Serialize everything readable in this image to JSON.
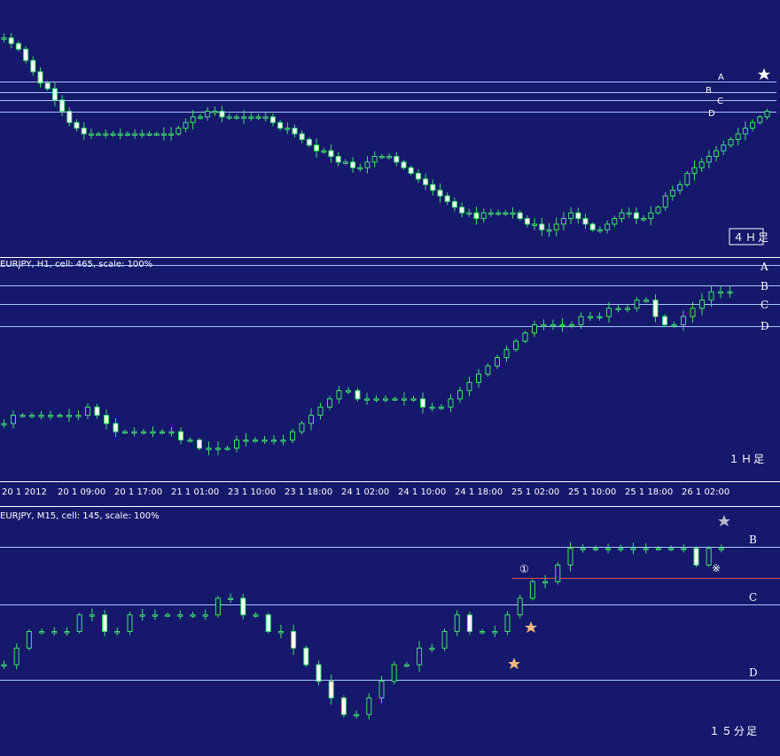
{
  "colors": {
    "background": "#16186b",
    "candle": "#3fe06a",
    "bear_body": "#ffffff",
    "level_line": "#a7c7ff",
    "separator": "#ffffff",
    "red_line": "#d45050",
    "star_white": "#ffffff",
    "star_gray": "#b7b7c9",
    "star_orange": "#f3b87b"
  },
  "panes": {
    "h4": {
      "timeframe_label": "４Ｈ足",
      "levels": [
        "A",
        "B",
        "C",
        "D"
      ]
    },
    "h1": {
      "header": "EURJPY, H1, cell: 465, scale: 100%",
      "timeframe_label": "１Ｈ足",
      "levels": [
        "A",
        "B",
        "C",
        "D"
      ],
      "time_axis": [
        "20 1 2012",
        "20 1 09:00",
        "20 1 17:00",
        "21 1 01:00",
        "23 1 10:00",
        "23 1 18:00",
        "24 1 02:00",
        "24 1 10:00",
        "24 1 18:00",
        "25 1 02:00",
        "25 1 10:00",
        "25 1 18:00",
        "26 1 02:00"
      ]
    },
    "m15": {
      "header": "EURJPY, M15, cell: 145, scale: 100%",
      "timeframe_label": "１５分足",
      "levels": [
        "B",
        "C",
        "D"
      ],
      "circled_mark": "①",
      "x_mark": "※"
    }
  },
  "chart_data": [
    {
      "type": "candlestick",
      "pane": "4H",
      "close": [
        96.0,
        95.9,
        95.8,
        95.6,
        95.4,
        95.2,
        95.1,
        94.9,
        94.7,
        94.5,
        94.4,
        94.3,
        94.3,
        94.3,
        94.3,
        94.3,
        94.3,
        94.3,
        94.3,
        94.3,
        94.3,
        94.3,
        94.3,
        94.3,
        94.4,
        94.5,
        94.6,
        94.6,
        94.7,
        94.7,
        94.6,
        94.6,
        94.6,
        94.6,
        94.6,
        94.6,
        94.6,
        94.5,
        94.4,
        94.4,
        94.3,
        94.2,
        94.1,
        94.0,
        94.0,
        93.9,
        93.8,
        93.8,
        93.7,
        93.7,
        93.8,
        93.9,
        93.9,
        93.9,
        93.8,
        93.7,
        93.6,
        93.5,
        93.4,
        93.3,
        93.2,
        93.1,
        93.0,
        92.9,
        92.9,
        92.8,
        92.9,
        92.9,
        92.9,
        92.9,
        92.9,
        92.8,
        92.7,
        92.7,
        92.6,
        92.6,
        92.7,
        92.8,
        92.9,
        92.8,
        92.7,
        92.6,
        92.6,
        92.7,
        92.8,
        92.9,
        92.9,
        92.8,
        92.8,
        92.9,
        93.0,
        93.2,
        93.3,
        93.4,
        93.6,
        93.7,
        93.8,
        93.9,
        94.0,
        94.1,
        94.2,
        94.3,
        94.4,
        94.5,
        94.6,
        94.7
      ],
      "levels": [
        "A",
        "B",
        "C",
        "D"
      ]
    },
    {
      "type": "candlestick",
      "pane": "H1",
      "time_axis_labels": [
        "20 1 2012",
        "20 1 09:00",
        "20 1 17:00",
        "21 1 01:00",
        "23 1 10:00",
        "23 1 18:00",
        "24 1 02:00",
        "24 1 10:00",
        "24 1 18:00",
        "25 1 02:00",
        "25 1 10:00",
        "25 1 18:00",
        "26 1 02:00"
      ],
      "close": [
        93.1,
        93.2,
        93.2,
        93.2,
        93.2,
        93.2,
        93.2,
        93.2,
        93.2,
        93.3,
        93.2,
        93.1,
        93.0,
        93.0,
        93.0,
        93.0,
        93.0,
        93.0,
        93.0,
        92.9,
        92.9,
        92.8,
        92.8,
        92.8,
        92.8,
        92.9,
        92.9,
        92.9,
        92.9,
        92.9,
        92.9,
        93.0,
        93.1,
        93.2,
        93.3,
        93.4,
        93.5,
        93.5,
        93.4,
        93.4,
        93.4,
        93.4,
        93.4,
        93.4,
        93.4,
        93.3,
        93.3,
        93.3,
        93.4,
        93.5,
        93.6,
        93.7,
        93.8,
        93.9,
        94.0,
        94.1,
        94.2,
        94.3,
        94.3,
        94.3,
        94.3,
        94.3,
        94.4,
        94.4,
        94.4,
        94.5,
        94.5,
        94.5,
        94.6,
        94.6,
        94.4,
        94.3,
        94.3,
        94.4,
        94.5,
        94.6,
        94.7,
        94.7,
        94.7
      ],
      "levels": [
        "A",
        "B",
        "C",
        "D"
      ]
    },
    {
      "type": "candlestick",
      "pane": "M15",
      "close": [
        94.3,
        94.4,
        94.5,
        94.5,
        94.5,
        94.5,
        94.6,
        94.6,
        94.5,
        94.5,
        94.6,
        94.6,
        94.6,
        94.6,
        94.6,
        94.6,
        94.6,
        94.7,
        94.7,
        94.6,
        94.6,
        94.5,
        94.5,
        94.4,
        94.3,
        94.2,
        94.1,
        94.0,
        94.0,
        94.1,
        94.2,
        94.3,
        94.3,
        94.4,
        94.4,
        94.5,
        94.6,
        94.5,
        94.5,
        94.5,
        94.6,
        94.7,
        94.8,
        94.8,
        94.9,
        95.0,
        95.0,
        95.0,
        95.0,
        95.0,
        95.0,
        95.0,
        95.0,
        95.0,
        95.0,
        94.9,
        95.0,
        95.0
      ],
      "levels": [
        "B",
        "C",
        "D"
      ]
    }
  ]
}
